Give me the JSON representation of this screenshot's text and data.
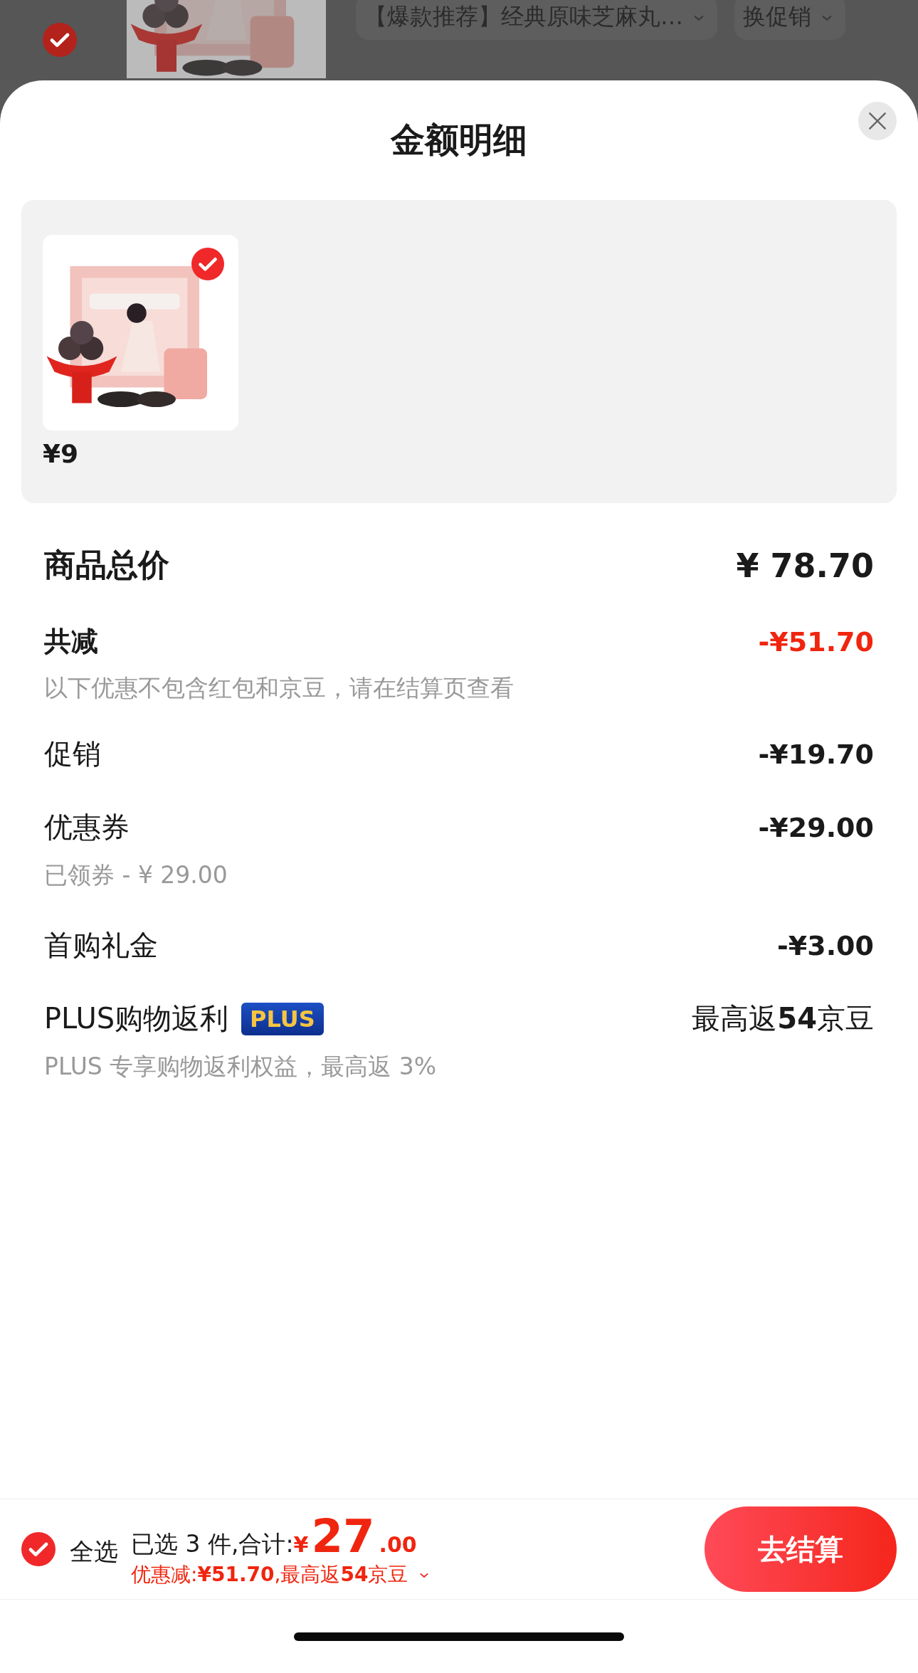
{
  "background_item": {
    "checked": true,
    "title": "【爆款推荐】经典原味芝麻丸…",
    "promo_button": "换促销"
  },
  "sheet": {
    "title": "金额明细"
  },
  "products": [
    {
      "checked": true,
      "price": "¥9"
    }
  ],
  "total": {
    "label": "商品总价",
    "value": "¥ 78.70"
  },
  "discount": {
    "label": "共减",
    "value": "-¥51.70",
    "note": "以下优惠不包含红包和京豆，请在结算页查看"
  },
  "details": [
    {
      "label": "促销",
      "value": "-¥19.70"
    },
    {
      "label": "优惠券",
      "value": "-¥29.00",
      "note": "已领券 - ¥ 29.00"
    },
    {
      "label": "首购礼金",
      "value": "-¥3.00"
    },
    {
      "label": "PLUS购物返利",
      "badge": "PLUS",
      "value": "最高返**54**京豆",
      "note": "PLUS 专享购物返利权益，最高返 3%"
    }
  ],
  "footer": {
    "select_all": {
      "checked": true,
      "label": "全选"
    },
    "summary_prefix": "已选 3 件,合计:",
    "currency": "¥",
    "amount_int": "27",
    "amount_dec": ".00",
    "savings": "优惠减:**¥51.70**,最高返**54**京豆",
    "checkout": "去结算"
  }
}
